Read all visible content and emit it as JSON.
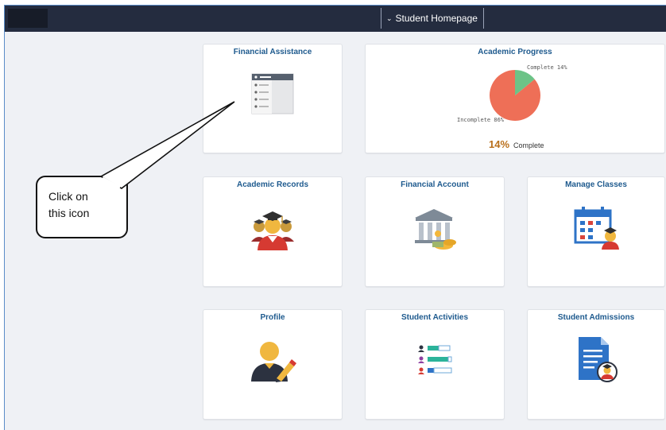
{
  "header": {
    "nav_title": "Student Homepage"
  },
  "tiles": {
    "financial_assistance": "Financial Assistance",
    "academic_progress": "Academic Progress",
    "academic_records": "Academic Records",
    "financial_account": "Financial Account",
    "manage_classes": "Manage Classes",
    "profile": "Profile",
    "student_activities": "Student Activities",
    "student_admissions": "Student Admissions"
  },
  "progress": {
    "complete_label": "Complete 14%",
    "incomplete_label": "Incomplete 86%",
    "complete_fraction": 0.14,
    "percent_value": "14%",
    "percent_text": "Complete",
    "colors": {
      "complete": "#6cc387",
      "incomplete": "#ee6f57"
    }
  },
  "callout": {
    "line1": "Click on",
    "line2": "this icon"
  },
  "colors": {
    "tile_title": "#1e5a8e",
    "topbar": "#242c3f",
    "accent": "#b96f1b"
  }
}
